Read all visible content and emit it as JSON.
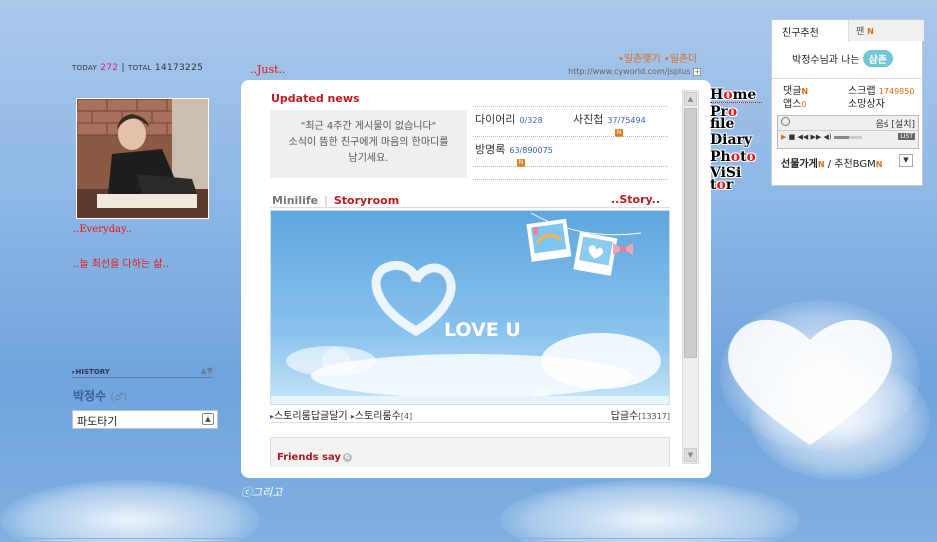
{
  "counter": {
    "today_label": "TODAY",
    "today_value": "272",
    "sep": "|",
    "total_label": "TOTAL",
    "total_value": "14173225"
  },
  "sidebar": {
    "everyday": "..Everyday..",
    "motto": "..늘 최선을 다하는 삶..",
    "history_label": "HISTORY",
    "owner_name": "박정수",
    "owner_suffix": "(♂)",
    "wave_label": "파도타기"
  },
  "title": {
    "mini_title": "..Just..",
    "top_links": "•일촌맺기 •일촌더",
    "url": "http://www.cyworld.com/jsplus"
  },
  "updated_news": {
    "title": "Updated news",
    "empty_line1": "\"최근 4주간 게시물이 없습니다\"",
    "empty_line2": "소식이 뜸한 친구에게 마음의 한마디를",
    "empty_line3": "남기세요."
  },
  "stats": {
    "diary_label": "다이어리",
    "diary_count": "0/328",
    "photo_label": "사진첩",
    "photo_count": "37/75494",
    "guestbook_label": "방명록",
    "guestbook_count": "63/890075",
    "rss_label": "N"
  },
  "minilife": {
    "tab_minilife": "Minilife",
    "tab_sep": "|",
    "tab_storyroom": "Storyroom",
    "story_title": "..Story..",
    "image_text": "LOVE U"
  },
  "story_footer": {
    "reply_label": "스토리룸답글달기",
    "count_label": "스토리룸수",
    "count_value": "[4]",
    "reply_count_label": "답글수",
    "reply_count_value": "[13317]"
  },
  "friends_say": {
    "label": "Friends say",
    "icon": "G"
  },
  "menu": {
    "home": [
      "H",
      "o",
      "me"
    ],
    "profile_1": [
      "Pr",
      "o"
    ],
    "profile_2": "file",
    "diary": "Diary",
    "photo": [
      "Ph",
      "o",
      "t",
      "o"
    ],
    "visitor_1": "ViSi",
    "visitor_2": [
      "t",
      "o",
      "r"
    ]
  },
  "widget": {
    "tab_friend": "친구추천",
    "tab_fan": "팬",
    "new_badge": "N",
    "relation_text": "박정수님과 나는",
    "relation_badge": "삼촌",
    "reply_label": "댓글",
    "scrap_label": "스크랩",
    "scrap_count": "1749850",
    "apps_label": "앱스",
    "apps_count": "0",
    "wish_label": "소망상자",
    "player_track": "음ś [설치]",
    "list_btn": "LIST",
    "volume": 0.55,
    "gift_label": "선물가게",
    "gift_sep": "/",
    "bgm_label": "추천BGM"
  },
  "signature": "ⓒ그리고",
  "colors": {
    "accent_red": "#c0191e",
    "accent_orange": "#e66a15",
    "link_blue": "#3867b2",
    "sky": "#8fb8e6"
  }
}
